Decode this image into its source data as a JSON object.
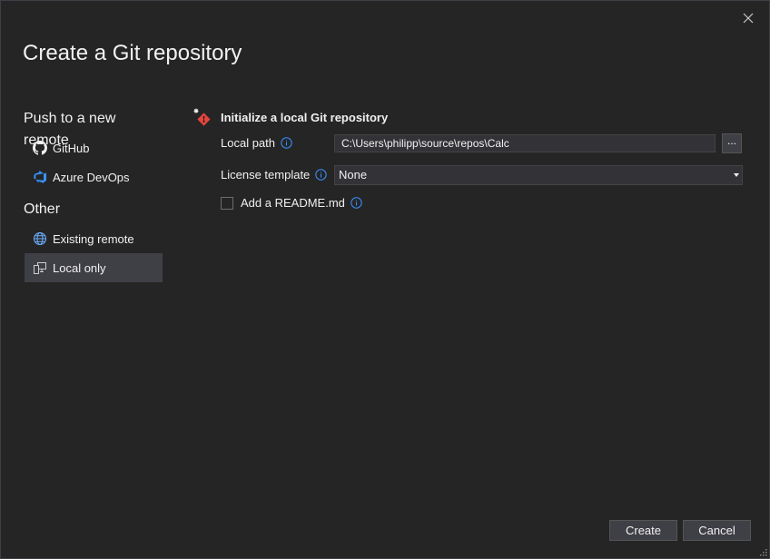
{
  "dialog": {
    "title": "Create a Git repository"
  },
  "sidebar": {
    "section_remote": "Push to a new remote",
    "remote_items": [
      {
        "label": "GitHub",
        "icon": "github-icon"
      },
      {
        "label": "Azure DevOps",
        "icon": "azure-devops-icon"
      }
    ],
    "section_other": "Other",
    "other_items": [
      {
        "label": "Existing remote",
        "icon": "globe-icon"
      },
      {
        "label": "Local only",
        "icon": "local-machine-icon",
        "selected": true
      }
    ]
  },
  "content": {
    "heading": "Initialize a local Git repository",
    "local_path_label": "Local path",
    "local_path_value": "C:\\Users\\philipp\\source\\repos\\Calc",
    "browse_label": "...",
    "license_label": "License template",
    "license_value": "None",
    "readme_label": "Add a README.md",
    "readme_checked": false
  },
  "buttons": {
    "create": "Create",
    "cancel": "Cancel"
  },
  "colors": {
    "accent_info": "#3794ff",
    "git_icon": "#e8453c",
    "selected_bg": "#3f3f46"
  }
}
